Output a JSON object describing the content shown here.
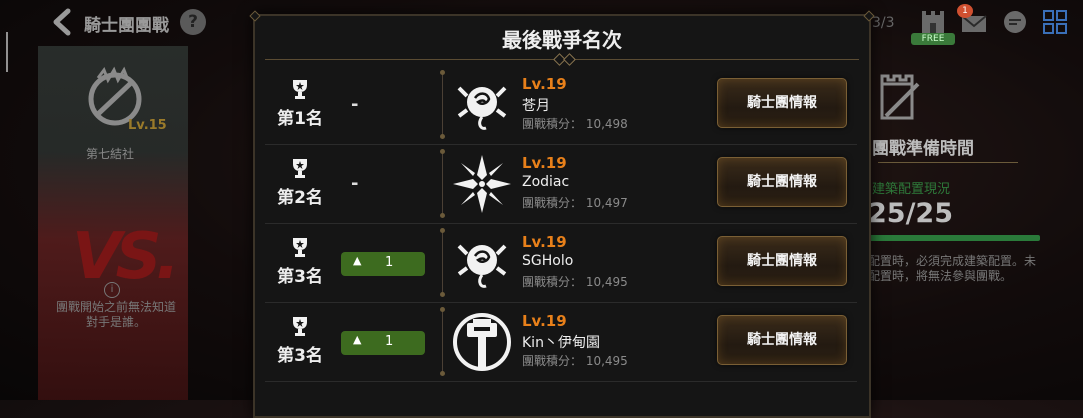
{
  "header": {
    "title": "騎士團團戰",
    "help_label": "?",
    "counter": "3/3",
    "free_badge": "FREE",
    "notification_count": "1"
  },
  "left_panel": {
    "guild_level": "Lv.15",
    "guild_name": "第七結社",
    "vs_text": "VS.",
    "info_icon": "i",
    "notice": "團戰開始之前無法知道對手是誰。"
  },
  "right_panel": {
    "prep_title": "團戰準備時間",
    "config_label": "建築配置現況",
    "config_value": "25/25",
    "notice": "配置時，必須完成建築配置。未配置時，將無法參與團戰。"
  },
  "modal": {
    "title": "最後戰爭名次",
    "rows": [
      {
        "rank": "第1名",
        "change": "-",
        "change_has_badge": false,
        "level": "Lv.19",
        "name": "苍月",
        "score": "團戰積分： 10,498",
        "emblem": "rose-icon",
        "button": "騎士團情報"
      },
      {
        "rank": "第2名",
        "change": "-",
        "change_has_badge": false,
        "level": "Lv.19",
        "name": "Zodiac",
        "score": "團戰積分： 10,497",
        "emblem": "star-burst-icon",
        "button": "騎士團情報"
      },
      {
        "rank": "第3名",
        "change": "1",
        "change_has_badge": true,
        "level": "Lv.19",
        "name": "SGHolo",
        "score": "團戰積分： 10,495",
        "emblem": "rose-icon",
        "button": "騎士團情報"
      },
      {
        "rank": "第3名",
        "change": "1",
        "change_has_badge": true,
        "level": "Lv.19",
        "name": "Kin丶伊甸園",
        "score": "團戰積分： 10,495",
        "emblem": "hammer-icon",
        "button": "騎士團情報"
      }
    ]
  },
  "colors": {
    "level_orange": "#e8801a",
    "badge_green": "#3d6b1f",
    "gold_border": "#7a5f35"
  }
}
